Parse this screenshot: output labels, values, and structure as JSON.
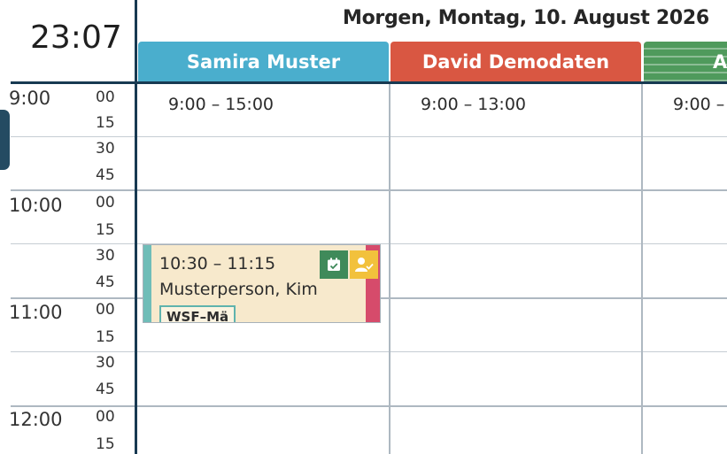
{
  "clock": {
    "time": "23:07"
  },
  "header": {
    "date_title": "Morgen, Montag, 10. August 2026"
  },
  "resources": [
    {
      "name": "Samira Muster",
      "color": "#4aaecd",
      "hours": "9:00 – 15:00"
    },
    {
      "name": "David Demodaten",
      "color": "#d95742",
      "hours": "9:00 – 13:00"
    },
    {
      "name": "A",
      "color": "#4f9a5c",
      "hours": "9:00 –"
    }
  ],
  "time_axis": {
    "hours": [
      "9:00",
      "10:00",
      "11:00",
      "12:00"
    ],
    "minutes": [
      "00",
      "15",
      "30",
      "45",
      "00",
      "15",
      "30",
      "45",
      "00",
      "15",
      "30",
      "45",
      "00",
      "15"
    ]
  },
  "appointment": {
    "time": "10:30 – 11:15",
    "person": "Musterperson, Kim",
    "tag": "WSF–Mä",
    "colors": {
      "background": "#f7e9cc",
      "accent": "#6fbdb8",
      "side": "#d64b6b",
      "calendar_icon": "#3f8a5a",
      "user_icon": "#f2c13c"
    },
    "icons": [
      "calendar-check-icon",
      "user-check-icon"
    ]
  }
}
